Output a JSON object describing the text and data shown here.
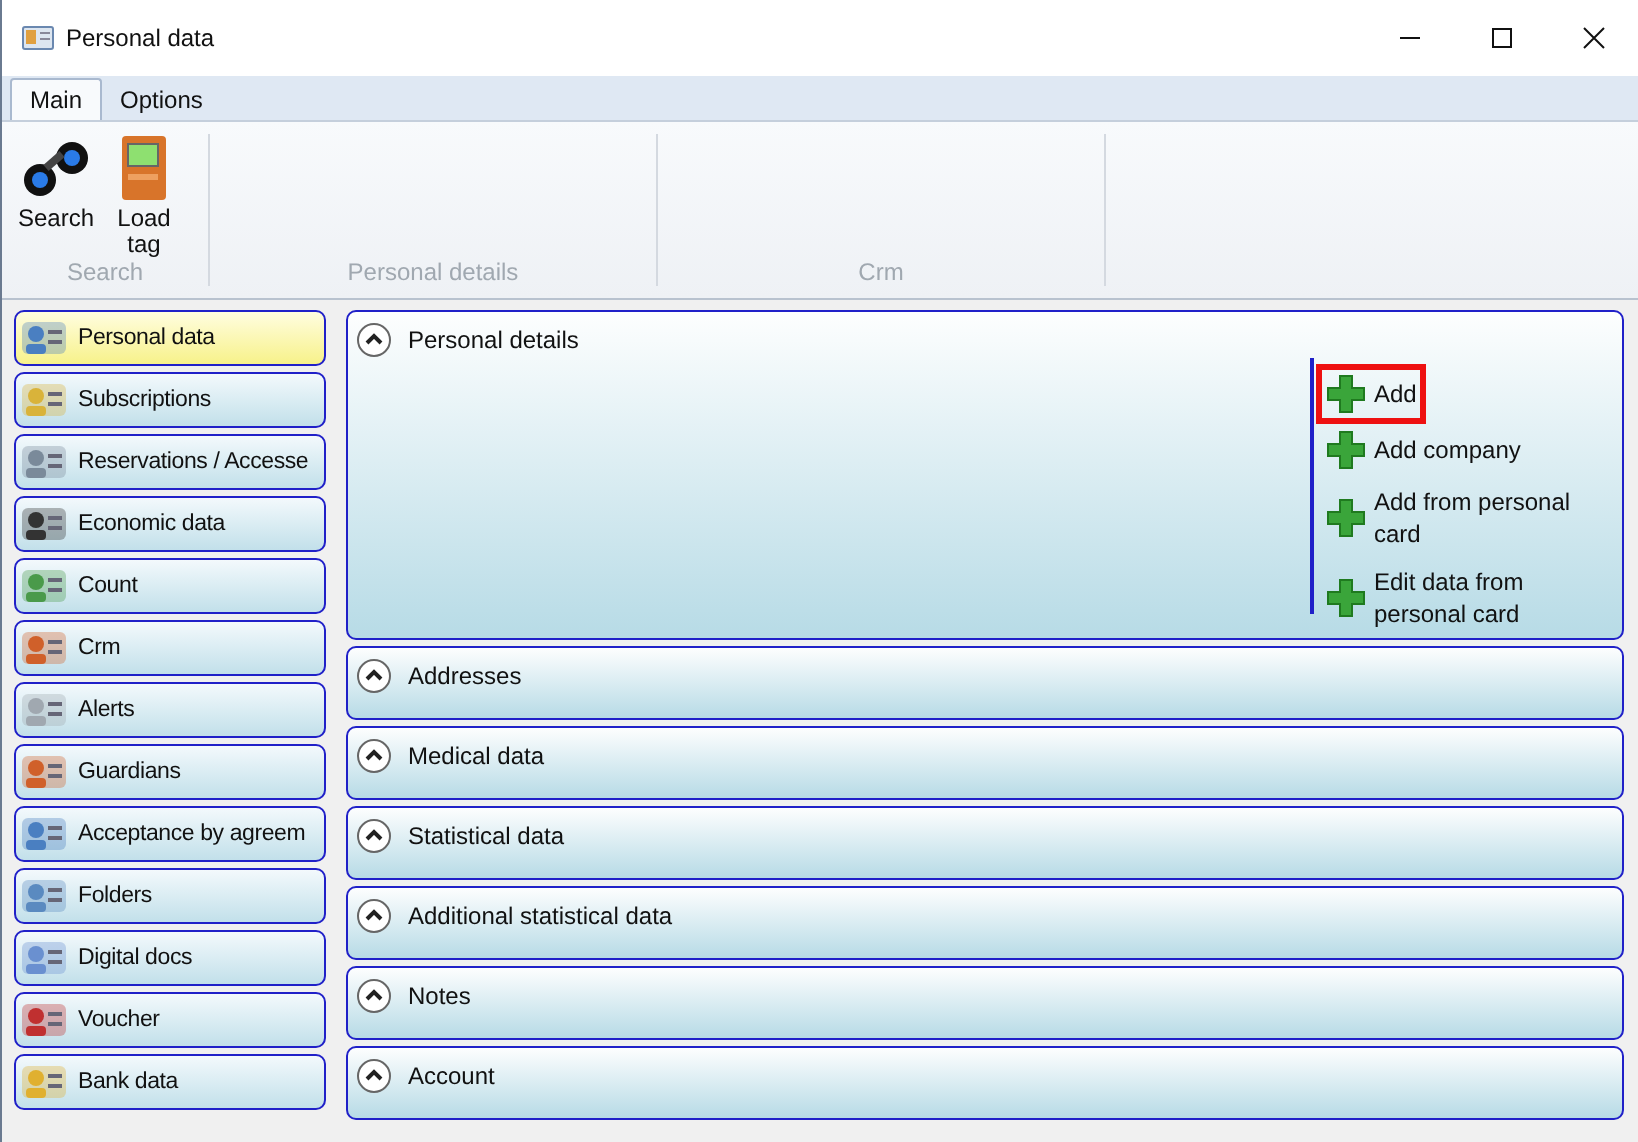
{
  "window": {
    "title": "Personal data"
  },
  "tabs": [
    {
      "label": "Main",
      "selected": true
    },
    {
      "label": "Options",
      "selected": false
    }
  ],
  "ribbon": {
    "groups": [
      {
        "label": "Search",
        "buttons": [
          {
            "label": "Search"
          },
          {
            "label": "Load tag"
          }
        ]
      },
      {
        "label": "Personal details"
      },
      {
        "label": "Crm"
      }
    ]
  },
  "sidebar": {
    "items": [
      {
        "label": "Personal data",
        "selected": true
      },
      {
        "label": "Subscriptions",
        "selected": false
      },
      {
        "label": "Reservations / Accesse",
        "selected": false
      },
      {
        "label": "Economic data",
        "selected": false
      },
      {
        "label": "Count",
        "selected": false
      },
      {
        "label": "Crm",
        "selected": false
      },
      {
        "label": "Alerts",
        "selected": false
      },
      {
        "label": "Guardians",
        "selected": false
      },
      {
        "label": "Acceptance by agreem",
        "selected": false
      },
      {
        "label": "Folders",
        "selected": false
      },
      {
        "label": "Digital docs",
        "selected": false
      },
      {
        "label": "Voucher",
        "selected": false
      },
      {
        "label": "Bank data",
        "selected": false
      }
    ]
  },
  "panels": [
    {
      "title": "Personal details",
      "expanded": true,
      "actions": [
        {
          "label": "Add",
          "highlighted": true
        },
        {
          "label": "Add company",
          "highlighted": false
        },
        {
          "label": "Add from personal card",
          "highlighted": false
        },
        {
          "label": "Edit data from personal card",
          "highlighted": false
        }
      ]
    },
    {
      "title": "Addresses",
      "expanded": false
    },
    {
      "title": "Medical data",
      "expanded": false
    },
    {
      "title": "Statistical data",
      "expanded": false
    },
    {
      "title": "Additional statistical data",
      "expanded": false
    },
    {
      "title": "Notes",
      "expanded": false
    },
    {
      "title": "Account",
      "expanded": false
    }
  ]
}
